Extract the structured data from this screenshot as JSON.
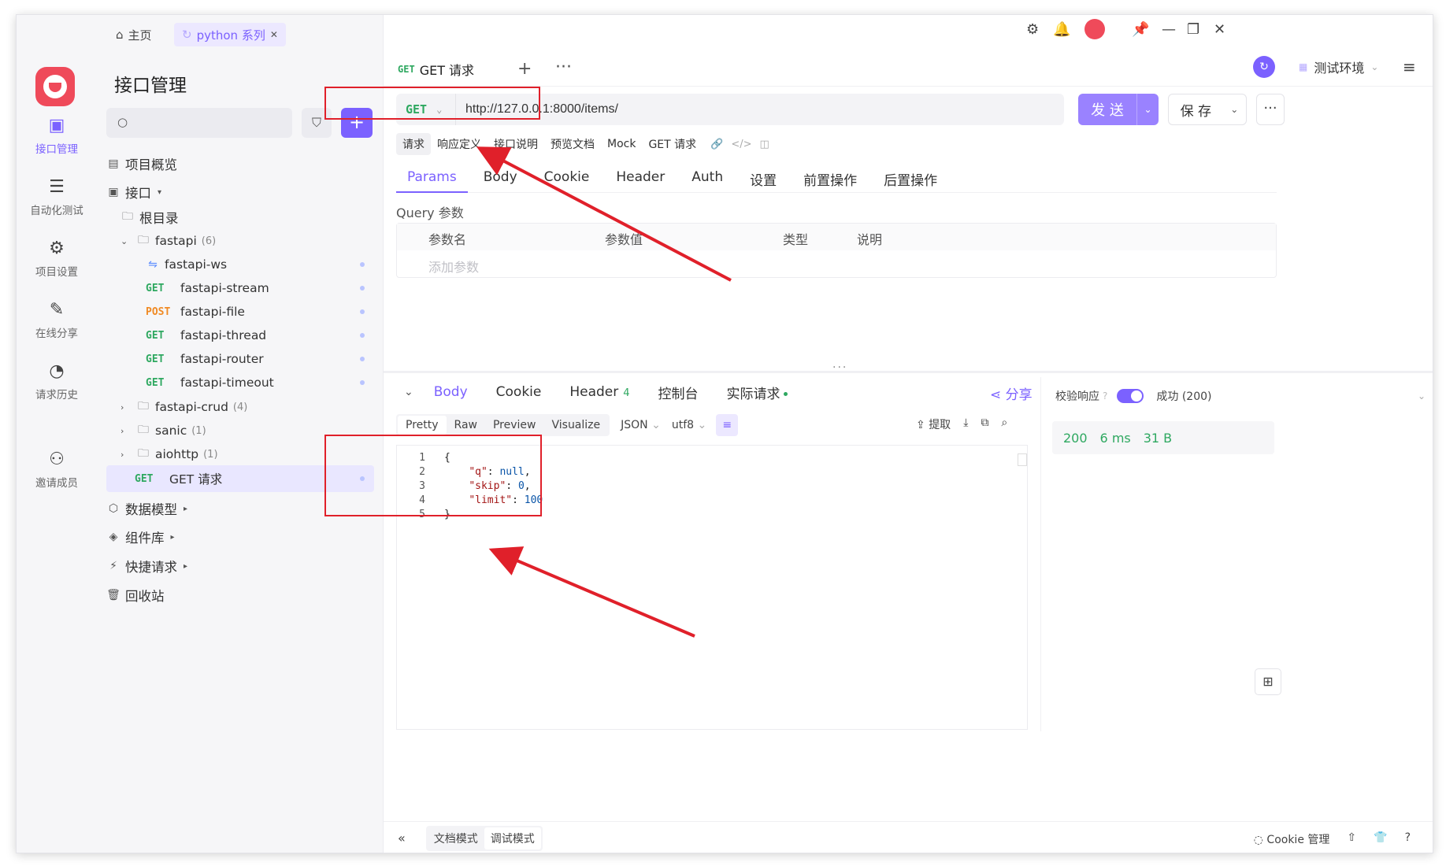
{
  "topbar": {
    "home_label": "主页",
    "project_tab_label": "python 系列",
    "close_glyph": "✕"
  },
  "rail": {
    "items": [
      {
        "label": "接口管理",
        "icon": "api-icon"
      },
      {
        "label": "自动化测试",
        "icon": "automation-icon"
      },
      {
        "label": "项目设置",
        "icon": "settings-icon"
      },
      {
        "label": "在线分享",
        "icon": "share-doc-icon"
      },
      {
        "label": "请求历史",
        "icon": "history-icon"
      },
      {
        "label": "邀请成员",
        "icon": "invite-icon"
      }
    ]
  },
  "sidebar": {
    "title": "接口管理",
    "overview": "项目概览",
    "interface": "接口",
    "root": "根目录",
    "folders": [
      {
        "name": "fastapi",
        "count": "(6)"
      },
      {
        "name": "fastapi-crud",
        "count": "(4)"
      },
      {
        "name": "sanic",
        "count": "(1)"
      },
      {
        "name": "aiohttp",
        "count": "(1)"
      }
    ],
    "endpoints": [
      {
        "method": "",
        "name": "fastapi-ws"
      },
      {
        "method": "GET",
        "name": "fastapi-stream"
      },
      {
        "method": "POST",
        "name": "fastapi-file"
      },
      {
        "method": "GET",
        "name": "fastapi-thread"
      },
      {
        "method": "GET",
        "name": "fastapi-router"
      },
      {
        "method": "GET",
        "name": "fastapi-timeout"
      }
    ],
    "selected": {
      "method": "GET",
      "name": "GET 请求"
    },
    "sections": [
      "数据模型",
      "组件库",
      "快捷请求",
      "回收站"
    ]
  },
  "request": {
    "tab_method": "GET",
    "tab_name": "GET 请求",
    "method": "GET",
    "url": "http://127.0.0.1:8000/items/",
    "send": "发 送",
    "save": "保 存",
    "env": "测试环境",
    "doc_tabs": [
      "请求",
      "响应定义",
      "接口说明",
      "预览文档",
      "Mock",
      "GET 请求"
    ],
    "tabs": [
      "Params",
      "Body",
      "Cookie",
      "Header",
      "Auth",
      "设置",
      "前置操作",
      "后置操作"
    ],
    "query_label": "Query 参数",
    "param_columns": [
      "参数名",
      "参数值",
      "类型",
      "说明"
    ],
    "param_placeholder": "添加参数"
  },
  "response": {
    "tabs": [
      "Body",
      "Cookie",
      "Header",
      "控制台",
      "实际请求"
    ],
    "header_count": "4",
    "share": "分享",
    "formats": [
      "Pretty",
      "Raw",
      "Preview",
      "Visualize"
    ],
    "format_type": "JSON",
    "encoding": "utf8",
    "extract": "提取",
    "lines": [
      {
        "n": "1",
        "text": "{"
      },
      {
        "n": "2",
        "key": "\"q\"",
        "value": "null",
        "tail": ","
      },
      {
        "n": "3",
        "key": "\"skip\"",
        "value": "0",
        "tail": ","
      },
      {
        "n": "4",
        "key": "\"limit\"",
        "value": "100",
        "tail": ""
      },
      {
        "n": "5",
        "text": "}"
      }
    ],
    "verify_label": "校验响应",
    "status_text": "成功 (200)",
    "status_code": "200",
    "time": "6 ms",
    "size": "31 B"
  },
  "footer": {
    "doc_mode": "文档模式",
    "debug_mode": "调试模式",
    "cookie_mgr": "Cookie 管理"
  },
  "colors": {
    "accent": "#7b61ff",
    "get": "#2ea860",
    "post": "#f08a24",
    "annotation": "#e0202a"
  }
}
